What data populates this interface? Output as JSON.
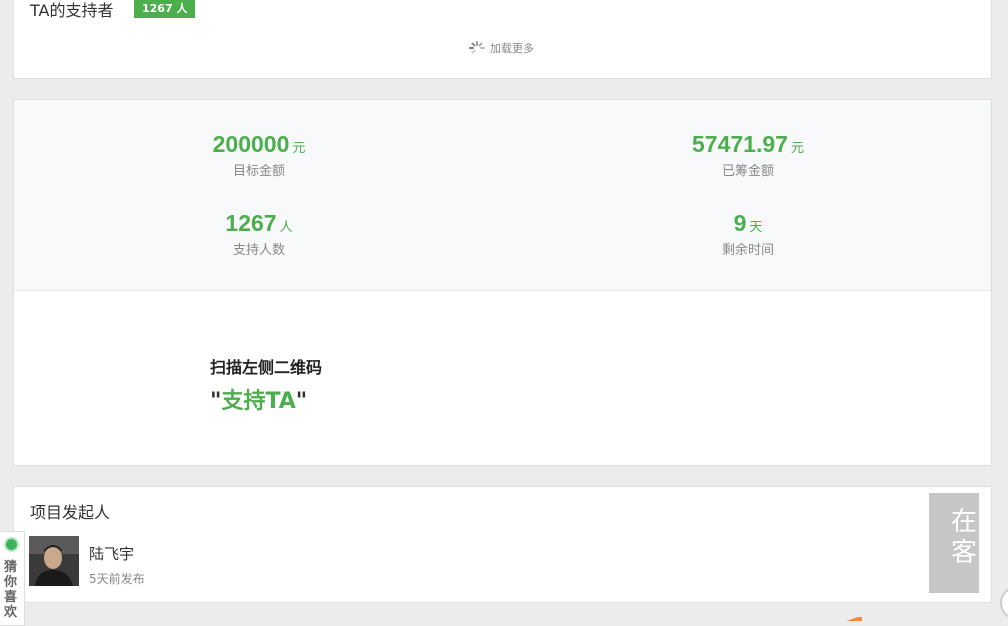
{
  "supporters": {
    "title": "TA的支持者",
    "count_badge": "1267 人",
    "load_more": "加载更多"
  },
  "stats": {
    "target": {
      "value": "200000",
      "unit": "元",
      "label": "目标金额"
    },
    "raised": {
      "value": "57471.97",
      "unit": "元",
      "label": "已筹金额"
    },
    "backers": {
      "value": "1267",
      "unit": "人",
      "label": "支持人数"
    },
    "days_left": {
      "value": "9",
      "unit": "天",
      "label": "剩余时间"
    }
  },
  "qr": {
    "instruction": "扫描左侧二维码",
    "open_quote": "\"",
    "cta": "支持TA",
    "close_quote": "\""
  },
  "initiator": {
    "heading": "项目发起人",
    "name": "陆飞宇",
    "posted": "5天前发布"
  },
  "floating": {
    "guess_label": "猜你喜欢",
    "service_label": "在客"
  },
  "colors": {
    "accent_green": "#4cae4c",
    "badge_green": "#4cae4c",
    "service_gray": "#c6c6c6"
  },
  "icons": {
    "loading": "spinner-icon",
    "status_dot": "online-dot-icon"
  }
}
